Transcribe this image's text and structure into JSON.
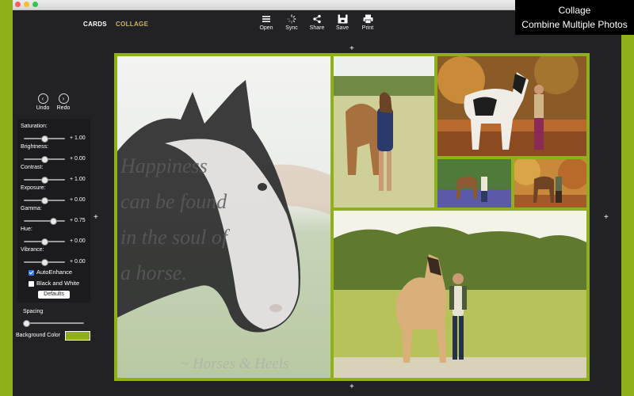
{
  "colors": {
    "accent_green": "#8fb01a",
    "panel_dark": "#222225",
    "tab_active": "#c9b46a",
    "checkbox_on": "#2f7bf6"
  },
  "mode_tabs": {
    "cards": "CARDS",
    "collage": "COLLAGE",
    "selected": "collage"
  },
  "toolbar": {
    "items": [
      {
        "label": "Open",
        "icon": "list-icon"
      },
      {
        "label": "Sync",
        "icon": "spinner-icon"
      },
      {
        "label": "Share",
        "icon": "share-icon"
      },
      {
        "label": "Save",
        "icon": "save-icon"
      },
      {
        "label": "Print",
        "icon": "printer-icon"
      }
    ]
  },
  "badge": {
    "line1": "Collage",
    "line2": "Combine Multiple Photos"
  },
  "history": {
    "undo": "Undo",
    "redo": "Redo"
  },
  "adjustments": [
    {
      "label": "Saturation:",
      "value": "+ 1.00",
      "level": 0.5
    },
    {
      "label": "Brightness:",
      "value": "+ 0.00",
      "level": 0.5
    },
    {
      "label": "Contrast:",
      "value": "+ 1.00",
      "level": 0.5
    },
    {
      "label": "Exposure:",
      "value": "+ 0.00",
      "level": 0.5
    },
    {
      "label": "Gamma:",
      "value": "+ 0.75",
      "level": 0.72
    },
    {
      "label": "Hue:",
      "value": "+ 0.00",
      "level": 0.5
    },
    {
      "label": "Vibrance:",
      "value": "+ 0.00",
      "level": 0.5
    }
  ],
  "options": {
    "auto_enhance": {
      "label": "AutoEnhance",
      "checked": true
    },
    "black_white": {
      "label": "Black and White",
      "checked": false
    },
    "defaults_button": "Defaults"
  },
  "spacing": {
    "label": "Spacing",
    "level": 0.0
  },
  "background_color": {
    "label": "Background Color",
    "value": "#8fb01a"
  },
  "add_buttons": {
    "symbol": "+"
  },
  "collage": {
    "quote_lines": [
      "Happiness",
      "can be found",
      "in the soul of",
      "a horse."
    ],
    "signature": "~ Horses & Heels"
  }
}
